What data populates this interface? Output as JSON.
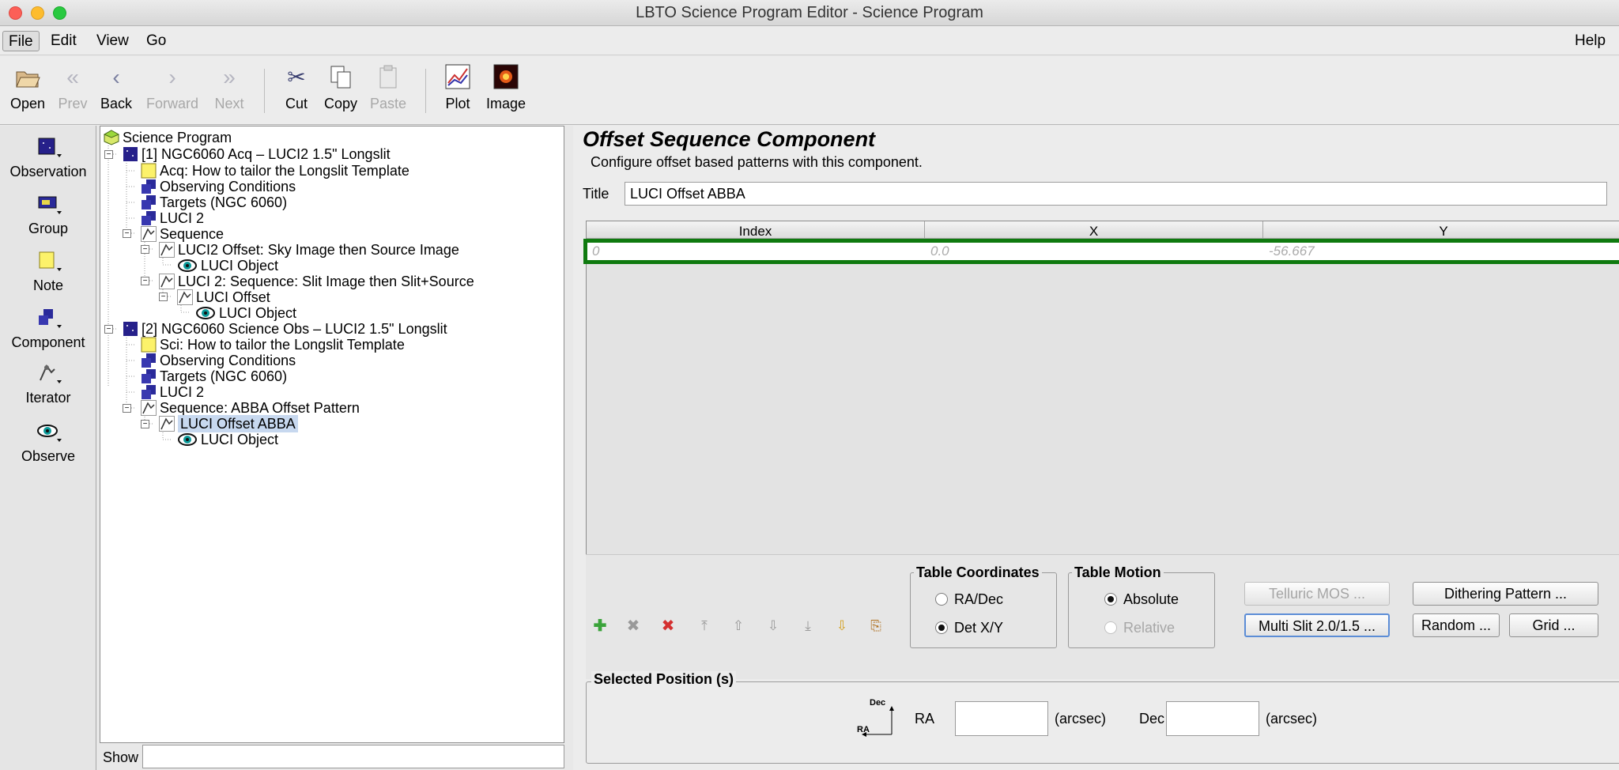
{
  "window": {
    "title": "LBTO Science Program Editor - Science Program"
  },
  "menu": {
    "file": "File",
    "edit": "Edit",
    "view": "View",
    "go": "Go",
    "help": "Help"
  },
  "toolbar": {
    "open": "Open",
    "prev": "Prev",
    "back": "Back",
    "forward": "Forward",
    "next": "Next",
    "cut": "Cut",
    "copy": "Copy",
    "paste": "Paste",
    "plot": "Plot",
    "image": "Image"
  },
  "palette": {
    "observation": "Observation",
    "group": "Group",
    "note": "Note",
    "component": "Component",
    "iterator": "Iterator",
    "observe": "Observe"
  },
  "tree": {
    "root": "Science Program",
    "obs1": "[1] NGC6060 Acq – LUCI2 1.5\" Longslit",
    "obs1_note": "Acq: How to tailor the Longslit Template",
    "obs1_cond": "Observing Conditions",
    "obs1_targets": "Targets (NGC 6060)",
    "obs1_inst": "LUCI 2",
    "obs1_seq": "Sequence",
    "obs1_off1": "LUCI2 Offset: Sky Image then Source Image",
    "obs1_obj1": "LUCI Object",
    "obs1_seq2": "LUCI 2: Sequence: Slit Image then Slit+Source",
    "obs1_off2": "LUCI Offset",
    "obs1_obj2": "LUCI Object",
    "obs2": "[2] NGC6060 Science Obs – LUCI2 1.5\" Longslit",
    "obs2_note": "Sci: How to tailor the Longslit Template",
    "obs2_cond": "Observing Conditions",
    "obs2_targets": "Targets (NGC 6060)",
    "obs2_inst": "LUCI 2",
    "obs2_seq": "Sequence: ABBA Offset Pattern",
    "obs2_off": "LUCI Offset ABBA",
    "obs2_obj": "LUCI Object"
  },
  "show": {
    "label": "Show",
    "value": ""
  },
  "editor": {
    "heading": "Offset Sequence Component",
    "subtitle": "Configure offset based patterns with this component.",
    "title_label": "Title",
    "title_value": "LUCI Offset ABBA",
    "columns": [
      "Index",
      "X",
      "Y"
    ],
    "rows": [
      {
        "index": "0",
        "x": "0.0",
        "y": "-56.667"
      }
    ]
  },
  "table_coords": {
    "legend": "Table Coordinates",
    "radec": "RA/Dec",
    "detxy": "Det X/Y",
    "selected": "Det X/Y"
  },
  "table_motion": {
    "legend": "Table Motion",
    "absolute": "Absolute",
    "relative": "Relative",
    "selected": "Absolute"
  },
  "buttons": {
    "telluric": "Telluric MOS ...",
    "multislit": "Multi Slit 2.0/1.5 ...",
    "dithering": "Dithering Pattern ...",
    "random": "Random ...",
    "grid": "Grid ..."
  },
  "selected_pos": {
    "legend": "Selected Position (s)",
    "ra_label": "RA",
    "dec_label": "Dec",
    "unit": "(arcsec)",
    "compass_dec": "Dec",
    "compass_ra": "RA",
    "ra_value": "",
    "dec_value": ""
  },
  "icons": {
    "add": "plus-icon",
    "remove": "x-icon",
    "remove_all": "red-x-icon",
    "top": "move-top-icon",
    "up": "move-up-icon",
    "down": "move-down-icon",
    "bottom": "move-bottom-icon",
    "import": "import-icon",
    "export": "export-icon"
  }
}
